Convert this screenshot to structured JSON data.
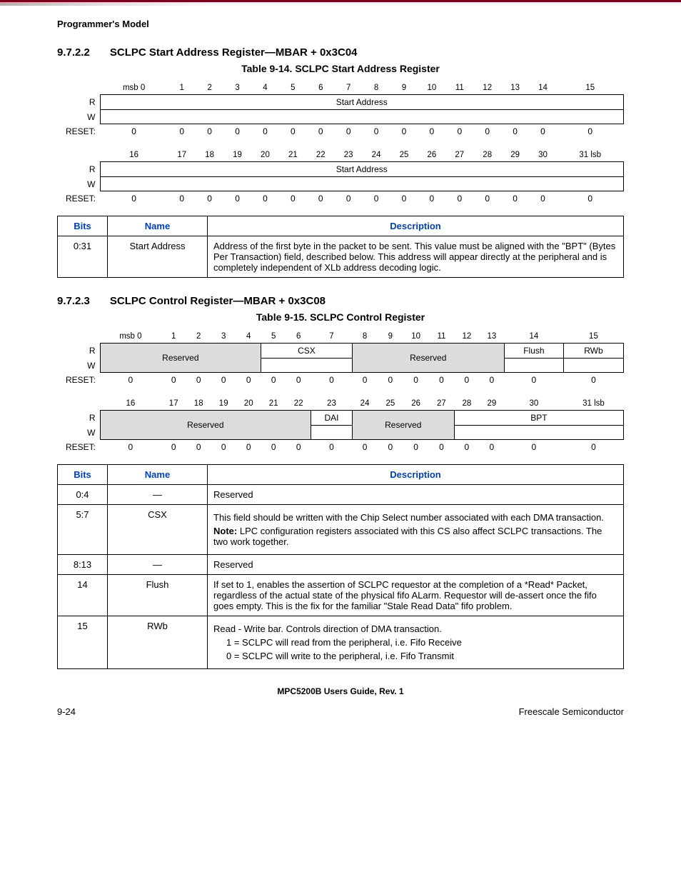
{
  "running_head": "Programmer's Model",
  "sec1": {
    "num": "9.7.2.2",
    "title": "SCLPC Start Address Register—MBAR + 0x3C04"
  },
  "cap1": "Table 9-14. SCLPC Start Address Register",
  "bits_hi": [
    "msb 0",
    "1",
    "2",
    "3",
    "4",
    "5",
    "6",
    "7",
    "8",
    "9",
    "10",
    "11",
    "12",
    "13",
    "14",
    "15"
  ],
  "bits_lo": [
    "16",
    "17",
    "18",
    "19",
    "20",
    "21",
    "22",
    "23",
    "24",
    "25",
    "26",
    "27",
    "28",
    "29",
    "30",
    "31 lsb"
  ],
  "rw": {
    "r": "R",
    "w": "W",
    "reset": "RESET:"
  },
  "reg1": {
    "field_hi": "Start Address",
    "field_lo": "Start Address"
  },
  "zeros": [
    "0",
    "0",
    "0",
    "0",
    "0",
    "0",
    "0",
    "0",
    "0",
    "0",
    "0",
    "0",
    "0",
    "0",
    "0",
    "0"
  ],
  "desc_headers": {
    "bits": "Bits",
    "name": "Name",
    "description": "Description"
  },
  "desc1_rows": [
    {
      "bits": "0:31",
      "name": "Start Address",
      "desc": "Address of the first byte in the packet to be sent. This value must be aligned with the \"BPT\" (Bytes Per Transaction) field, described below. This address will appear directly at the peripheral and is completely independent of XLb address decoding logic."
    }
  ],
  "sec2": {
    "num": "9.7.2.3",
    "title": "SCLPC Control Register—MBAR + 0x3C08"
  },
  "cap2": "Table 9-15. SCLPC Control Register",
  "reg2": {
    "hi": {
      "res1": "Reserved",
      "csx": "CSX",
      "res2": "Reserved",
      "flush": "Flush",
      "rwb": "RWb"
    },
    "lo": {
      "res1": "Reserved",
      "dai": "DAI",
      "res2": "Reserved",
      "bpt": "BPT"
    }
  },
  "desc2_rows": [
    {
      "bits": "0:4",
      "name": "—",
      "desc": "Reserved"
    },
    {
      "bits": "5:7",
      "name": "CSX",
      "desc": "This field should be written with the Chip Select number associated with each DMA transaction.",
      "note": "LPC configuration registers associated with this CS also affect SCLPC transactions. The two work together."
    },
    {
      "bits": "8:13",
      "name": "—",
      "desc": "Reserved"
    },
    {
      "bits": "14",
      "name": "Flush",
      "desc": "If set to 1, enables the assertion of SCLPC requestor at the completion of a *Read* Packet, regardless of the actual state of the physical fifo ALarm. Requestor will de-assert once the fifo goes empty. This is the fix for the familiar \"Stale Read Data\" fifo problem."
    },
    {
      "bits": "15",
      "name": "RWb",
      "desc": "Read - Write bar. Controls direction of DMA transaction.",
      "l1": "1 = SCLPC will read from the peripheral, i.e. Fifo Receive",
      "l0": "0 = SCLPC will write to the peripheral, i.e. Fifo Transmit"
    }
  ],
  "note_label": "Note:",
  "footer": {
    "center": "MPC5200B Users Guide, Rev. 1",
    "left": "9-24",
    "right": "Freescale Semiconductor"
  }
}
